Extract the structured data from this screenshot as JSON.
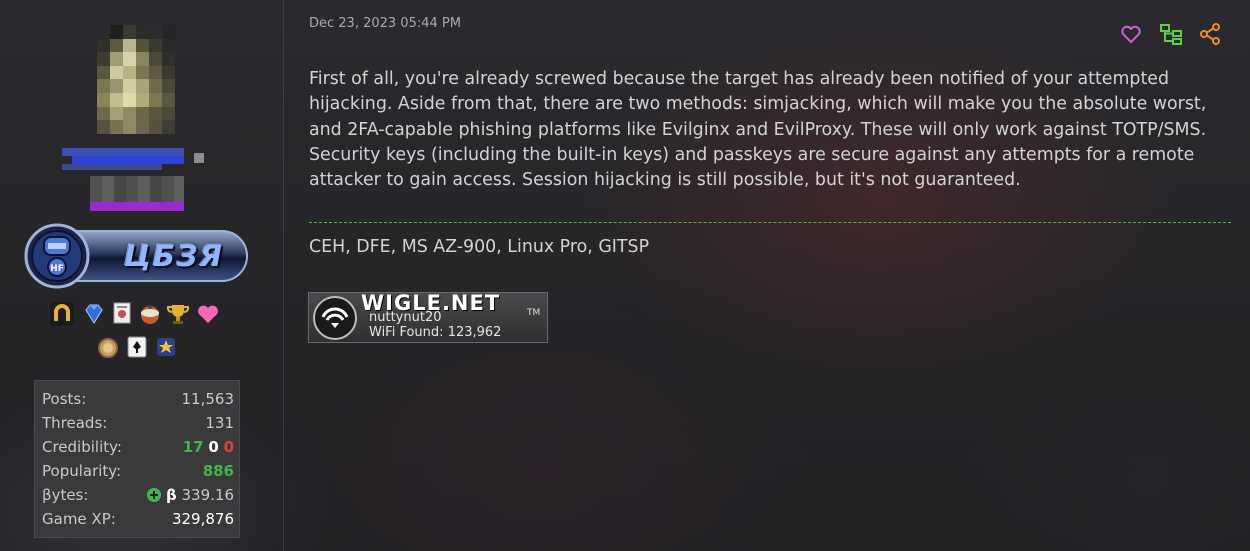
{
  "post": {
    "date": "Dec 23, 2023 05:44 PM",
    "body": "First of all, you're already screwed because the target has already been notified of your attempted hijacking. Aside from that, there are two methods: simjacking, which will make you the absolute worst, and 2FA-capable phishing platforms like Evilginx and EvilProxy. These will only work against TOTP/SMS. Security keys (including the built-in keys) and passkeys are secure against any attempts for a remote attacker to gain access. Session hijacking is still possible, but it's not guaranteed.",
    "actions": [
      {
        "icon": "heart-icon",
        "color": "#d45ad9"
      },
      {
        "icon": "thread-tree-icon",
        "color": "#5bd23e"
      },
      {
        "icon": "share-icon",
        "color": "#f08a24"
      }
    ]
  },
  "signature": {
    "text": "CEH, DFE, MS AZ-900, Linux Pro, GITSP",
    "wigle": {
      "title": "WIGLE.NET",
      "tm": "TM",
      "user": "nuttynut20",
      "found_label": "WiFi Found:",
      "found_value": "123,962"
    }
  },
  "user": {
    "group_badge_text": "ЦБЗЯ",
    "group_badge_emblem": "HF",
    "awards": [
      "horseshoe-icon",
      "gem-icon",
      "certificate-icon",
      "rocket-icon",
      "trophy-icon",
      "heart-icon",
      "medal-icon",
      "cards-icon",
      "star-badge-icon"
    ],
    "stats": {
      "posts_label": "Posts:",
      "posts": "11,563",
      "threads_label": "Threads:",
      "threads": "131",
      "credibility_label": "Credibility:",
      "cred_pos": "17",
      "cred_neu": "0",
      "cred_neg": "0",
      "popularity_label": "Popularity:",
      "popularity": "886",
      "bytes_label": "βytes:",
      "bytes_symbol": "β",
      "bytes": "339.16",
      "gamexp_label": "Game XP:",
      "gamexp": "329,876"
    }
  },
  "colors": {
    "accent_green": "#43b649",
    "accent_red": "#e0413c",
    "divider": "#55b43c",
    "badge_text": "#8fb6ff"
  }
}
